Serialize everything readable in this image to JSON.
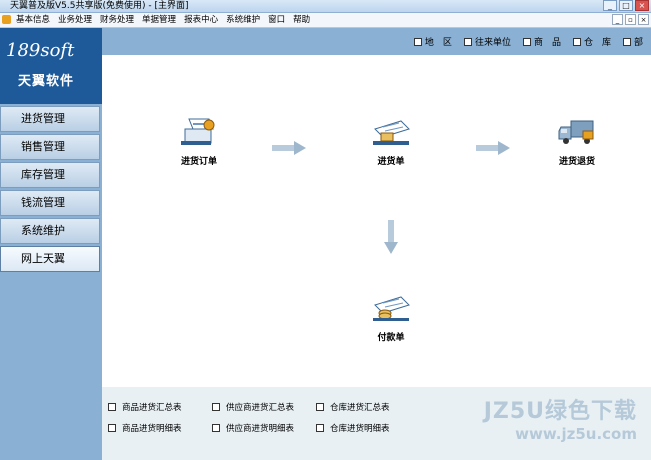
{
  "window": {
    "title": "天翼普及版V5.5共享版(免费使用) - [主界面]"
  },
  "menubar": {
    "items": [
      "基本信息",
      "业务处理",
      "财务处理",
      "单据管理",
      "报表中心",
      "系统维护",
      "窗口",
      "帮助"
    ]
  },
  "sidebar": {
    "logo_line1": "189soft",
    "logo_line2": "天翼软件",
    "items": [
      "进货管理",
      "销售管理",
      "库存管理",
      "钱流管理",
      "系统维护",
      "网上天翼"
    ],
    "active_index": 5
  },
  "filters": [
    "地　区",
    "往来单位",
    "商　品",
    "仓　库",
    "部"
  ],
  "flow": {
    "nodes": [
      {
        "label": "进货订单",
        "icon": "purchase-order-icon"
      },
      {
        "label": "进货单",
        "icon": "purchase-bill-icon"
      },
      {
        "label": "进货退货",
        "icon": "purchase-return-truck-icon"
      },
      {
        "label": "付款单",
        "icon": "payment-bill-icon"
      }
    ]
  },
  "reports": {
    "items": [
      "商品进货汇总表",
      "供应商进货汇总表",
      "仓库进货汇总表",
      "商品进货明细表",
      "供应商进货明细表",
      "仓库进货明细表"
    ]
  },
  "watermark": {
    "line1": "JZ5U绿色下载",
    "line2": "www.jz5u.com"
  },
  "colors": {
    "sidebar": "#8ab0d3",
    "logo_bg": "#1e5a99",
    "arrow": "#9fb7cc"
  }
}
